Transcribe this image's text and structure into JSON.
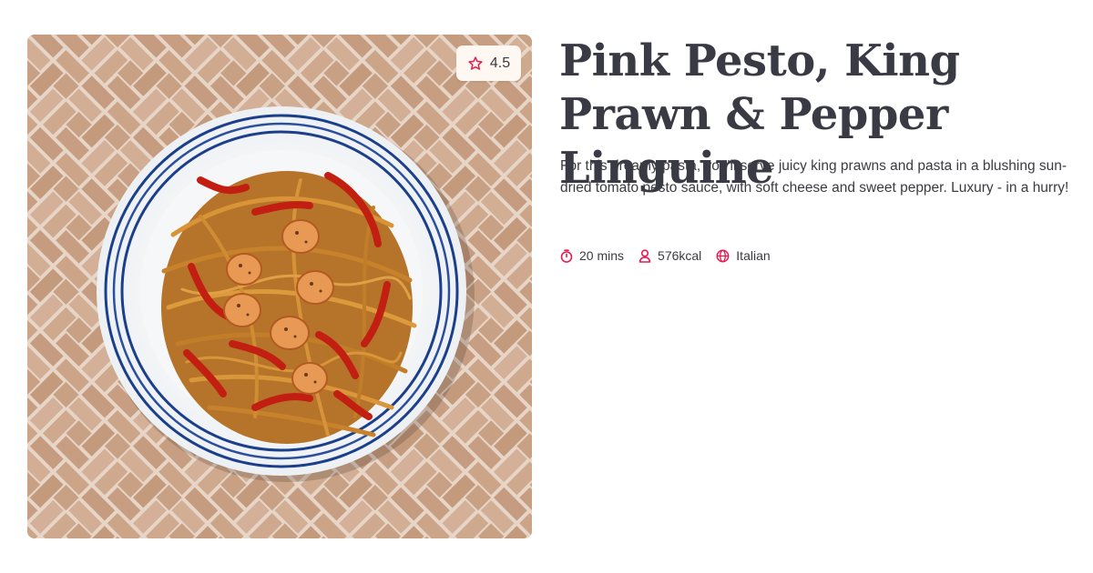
{
  "recipe": {
    "title": "Pink Pesto, King Prawn & Pepper Linguine",
    "description": "For this dreamy pasta, you'll serve juicy king prawns and pasta in a blushing sun-dried tomato pesto sauce, with soft cheese and sweet pepper. Luxury - in a hurry!",
    "rating": "4.5",
    "meta": {
      "time": "20 mins",
      "calories": "576kcal",
      "cuisine": "Italian"
    }
  },
  "icons": {
    "rating": "star-icon",
    "time": "stopwatch-icon",
    "calories": "person-icon",
    "cuisine": "globe-icon"
  },
  "colors": {
    "accent": "#e8194d",
    "title": "#3a3a45",
    "text": "#3b3b42",
    "badge_bg": "#fff7f2"
  }
}
